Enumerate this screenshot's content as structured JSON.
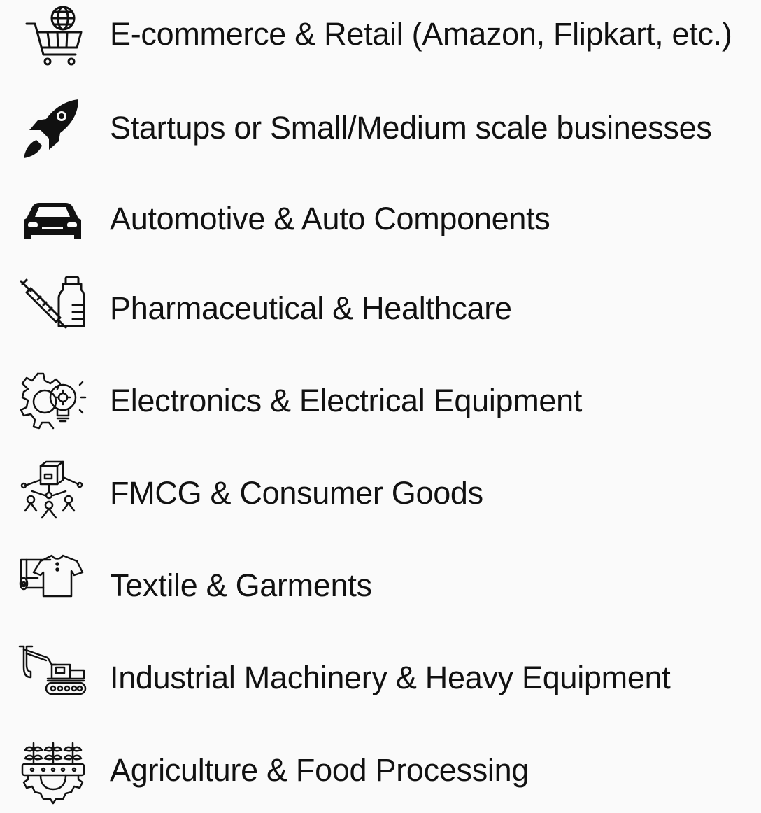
{
  "industries": [
    {
      "icon": "shopping-cart-globe-icon",
      "label": "E-commerce & Retail (Amazon, Flipkart, etc.)"
    },
    {
      "icon": "rocket-icon",
      "label": "Startups or Small/Medium scale businesses"
    },
    {
      "icon": "car-icon",
      "label": "Automotive & Auto Components"
    },
    {
      "icon": "syringe-vial-icon",
      "label": "Pharmaceutical & Healthcare"
    },
    {
      "icon": "gear-lightbulb-icon",
      "label": "Electronics & Electrical Equipment"
    },
    {
      "icon": "box-network-icon",
      "label": "FMCG & Consumer Goods"
    },
    {
      "icon": "fabric-shirt-icon",
      "label": "Textile & Garments"
    },
    {
      "icon": "excavator-icon",
      "label": "Industrial Machinery & Heavy Equipment"
    },
    {
      "icon": "plants-gear-icon",
      "label": "Agriculture & Food Processing"
    }
  ],
  "colors": {
    "text": "#111111",
    "background": "#fafafa"
  }
}
